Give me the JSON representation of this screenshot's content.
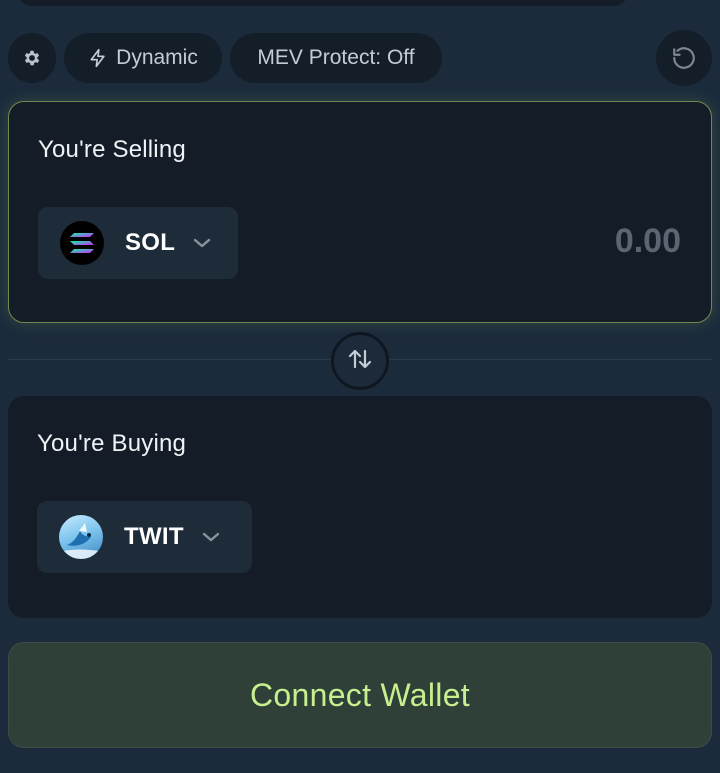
{
  "toolbar": {
    "settings_icon": "gear-icon",
    "dynamic_icon": "lightning-icon",
    "dynamic_label": "Dynamic",
    "mev_label": "MEV Protect: Off",
    "refresh_icon": "refresh-icon"
  },
  "selling": {
    "title": "You're Selling",
    "token_symbol": "SOL",
    "amount": "0.00"
  },
  "buying": {
    "title": "You're Buying",
    "token_symbol": "TWIT"
  },
  "swap_icon": "swap-arrows-icon",
  "connect": {
    "label": "Connect Wallet"
  },
  "colors": {
    "background": "#1c2b3b",
    "card": "#131c27",
    "accent": "#c7ef8f",
    "selected_border": "#6e8a4e"
  }
}
